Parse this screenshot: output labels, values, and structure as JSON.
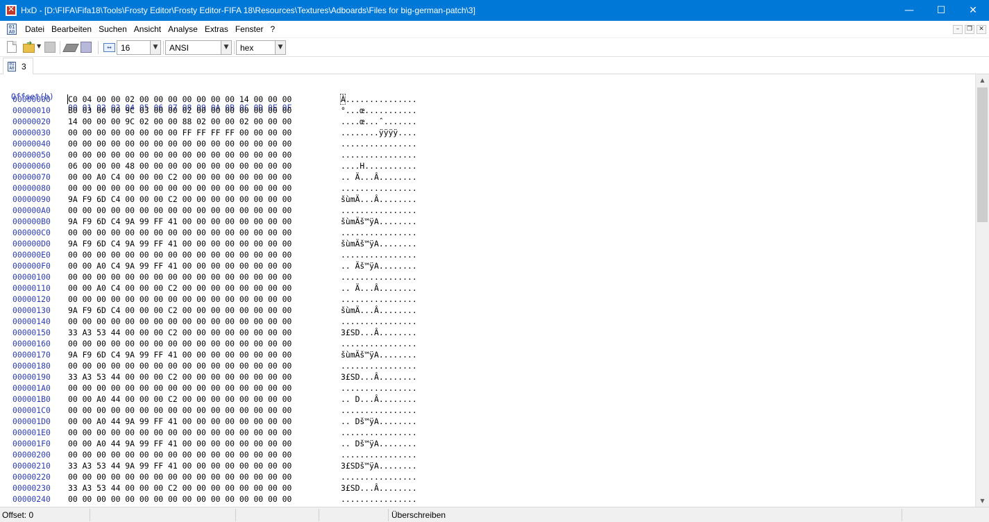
{
  "window": {
    "title": "HxD - [D:\\FIFA\\Fifa18\\Tools\\Frosty Editor\\Frosty Editor-FIFA 18\\Resources\\Textures\\Adboards\\Files for big-german-patch\\3]",
    "controls": {
      "minimize": "—",
      "maximize": "☐",
      "close": "✕"
    }
  },
  "menu": {
    "items": [
      "Datei",
      "Bearbeiten",
      "Suchen",
      "Ansicht",
      "Analyse",
      "Extras",
      "Fenster",
      "?"
    ],
    "mdi": {
      "minimize": "–",
      "restore": "❐",
      "close": "✕"
    }
  },
  "toolbar": {
    "columns_value": "16",
    "charset_value": "ANSI",
    "offset_base_value": "hex"
  },
  "tabs": [
    {
      "label": "3"
    }
  ],
  "hex": {
    "header_offset": "Offset(h)",
    "header_columns": "00 01 02 03 04 05 06 07 08 09 0A 0B 0C 0D 0E 0F",
    "rows": [
      {
        "offset": "00000000",
        "bytes": "C0 04 00 00 02 00 00 00 00 00 00 00 14 00 00 00",
        "ascii": "À..............."
      },
      {
        "offset": "00000010",
        "bytes": "B0 03 00 00 9C 03 00 00 02 00 00 00 00 00 00 00",
        "ascii": "°...œ..........."
      },
      {
        "offset": "00000020",
        "bytes": "14 00 00 00 9C 02 00 00 88 02 00 00 02 00 00 00",
        "ascii": "....œ...ˆ......."
      },
      {
        "offset": "00000030",
        "bytes": "00 00 00 00 00 00 00 00 FF FF FF FF 00 00 00 00",
        "ascii": "........ÿÿÿÿ...."
      },
      {
        "offset": "00000040",
        "bytes": "00 00 00 00 00 00 00 00 00 00 00 00 00 00 00 00",
        "ascii": "................"
      },
      {
        "offset": "00000050",
        "bytes": "00 00 00 00 00 00 00 00 00 00 00 00 00 00 00 00",
        "ascii": "................"
      },
      {
        "offset": "00000060",
        "bytes": "06 00 00 00 48 00 00 00 00 00 00 00 00 00 00 00",
        "ascii": "....H..........."
      },
      {
        "offset": "00000070",
        "bytes": "00 00 A0 C4 00 00 00 C2 00 00 00 00 00 00 00 00",
        "ascii": ".. Ä...Â........"
      },
      {
        "offset": "00000080",
        "bytes": "00 00 00 00 00 00 00 00 00 00 00 00 00 00 00 00",
        "ascii": "................"
      },
      {
        "offset": "00000090",
        "bytes": "9A F9 6D C4 00 00 00 C2 00 00 00 00 00 00 00 00",
        "ascii": "šùmÄ...Â........"
      },
      {
        "offset": "000000A0",
        "bytes": "00 00 00 00 00 00 00 00 00 00 00 00 00 00 00 00",
        "ascii": "................"
      },
      {
        "offset": "000000B0",
        "bytes": "9A F9 6D C4 9A 99 FF 41 00 00 00 00 00 00 00 00",
        "ascii": "šùmÄš™ÿA........"
      },
      {
        "offset": "000000C0",
        "bytes": "00 00 00 00 00 00 00 00 00 00 00 00 00 00 00 00",
        "ascii": "................"
      },
      {
        "offset": "000000D0",
        "bytes": "9A F9 6D C4 9A 99 FF 41 00 00 00 00 00 00 00 00",
        "ascii": "šùmÄš™ÿA........"
      },
      {
        "offset": "000000E0",
        "bytes": "00 00 00 00 00 00 00 00 00 00 00 00 00 00 00 00",
        "ascii": "................"
      },
      {
        "offset": "000000F0",
        "bytes": "00 00 A0 C4 9A 99 FF 41 00 00 00 00 00 00 00 00",
        "ascii": ".. Äš™ÿA........"
      },
      {
        "offset": "00000100",
        "bytes": "00 00 00 00 00 00 00 00 00 00 00 00 00 00 00 00",
        "ascii": "................"
      },
      {
        "offset": "00000110",
        "bytes": "00 00 A0 C4 00 00 00 C2 00 00 00 00 00 00 00 00",
        "ascii": ".. Ä...Â........"
      },
      {
        "offset": "00000120",
        "bytes": "00 00 00 00 00 00 00 00 00 00 00 00 00 00 00 00",
        "ascii": "................"
      },
      {
        "offset": "00000130",
        "bytes": "9A F9 6D C4 00 00 00 C2 00 00 00 00 00 00 00 00",
        "ascii": "šùmÄ...Â........"
      },
      {
        "offset": "00000140",
        "bytes": "00 00 00 00 00 00 00 00 00 00 00 00 00 00 00 00",
        "ascii": "................"
      },
      {
        "offset": "00000150",
        "bytes": "33 A3 53 44 00 00 00 C2 00 00 00 00 00 00 00 00",
        "ascii": "3£SD...Â........"
      },
      {
        "offset": "00000160",
        "bytes": "00 00 00 00 00 00 00 00 00 00 00 00 00 00 00 00",
        "ascii": "................"
      },
      {
        "offset": "00000170",
        "bytes": "9A F9 6D C4 9A 99 FF 41 00 00 00 00 00 00 00 00",
        "ascii": "šùmÄš™ÿA........"
      },
      {
        "offset": "00000180",
        "bytes": "00 00 00 00 00 00 00 00 00 00 00 00 00 00 00 00",
        "ascii": "................"
      },
      {
        "offset": "00000190",
        "bytes": "33 A3 53 44 00 00 00 C2 00 00 00 00 00 00 00 00",
        "ascii": "3£SD...Â........"
      },
      {
        "offset": "000001A0",
        "bytes": "00 00 00 00 00 00 00 00 00 00 00 00 00 00 00 00",
        "ascii": "................"
      },
      {
        "offset": "000001B0",
        "bytes": "00 00 A0 44 00 00 00 C2 00 00 00 00 00 00 00 00",
        "ascii": ".. D...Â........"
      },
      {
        "offset": "000001C0",
        "bytes": "00 00 00 00 00 00 00 00 00 00 00 00 00 00 00 00",
        "ascii": "................"
      },
      {
        "offset": "000001D0",
        "bytes": "00 00 A0 44 9A 99 FF 41 00 00 00 00 00 00 00 00",
        "ascii": ".. Dš™ÿA........"
      },
      {
        "offset": "000001E0",
        "bytes": "00 00 00 00 00 00 00 00 00 00 00 00 00 00 00 00",
        "ascii": "................"
      },
      {
        "offset": "000001F0",
        "bytes": "00 00 A0 44 9A 99 FF 41 00 00 00 00 00 00 00 00",
        "ascii": ".. Dš™ÿA........"
      },
      {
        "offset": "00000200",
        "bytes": "00 00 00 00 00 00 00 00 00 00 00 00 00 00 00 00",
        "ascii": "................"
      },
      {
        "offset": "00000210",
        "bytes": "33 A3 53 44 9A 99 FF 41 00 00 00 00 00 00 00 00",
        "ascii": "3£SDš™ÿA........"
      },
      {
        "offset": "00000220",
        "bytes": "00 00 00 00 00 00 00 00 00 00 00 00 00 00 00 00",
        "ascii": "................"
      },
      {
        "offset": "00000230",
        "bytes": "33 A3 53 44 00 00 00 C2 00 00 00 00 00 00 00 00",
        "ascii": "3£SD...Â........"
      },
      {
        "offset": "00000240",
        "bytes": "00 00 00 00 00 00 00 00 00 00 00 00 00 00 00 00",
        "ascii": "................"
      }
    ]
  },
  "status": {
    "offset": "Offset: 0",
    "mode": "Überschreiben"
  },
  "colors": {
    "titlebar": "#0078d7",
    "offset_text": "#2b3bb4"
  }
}
